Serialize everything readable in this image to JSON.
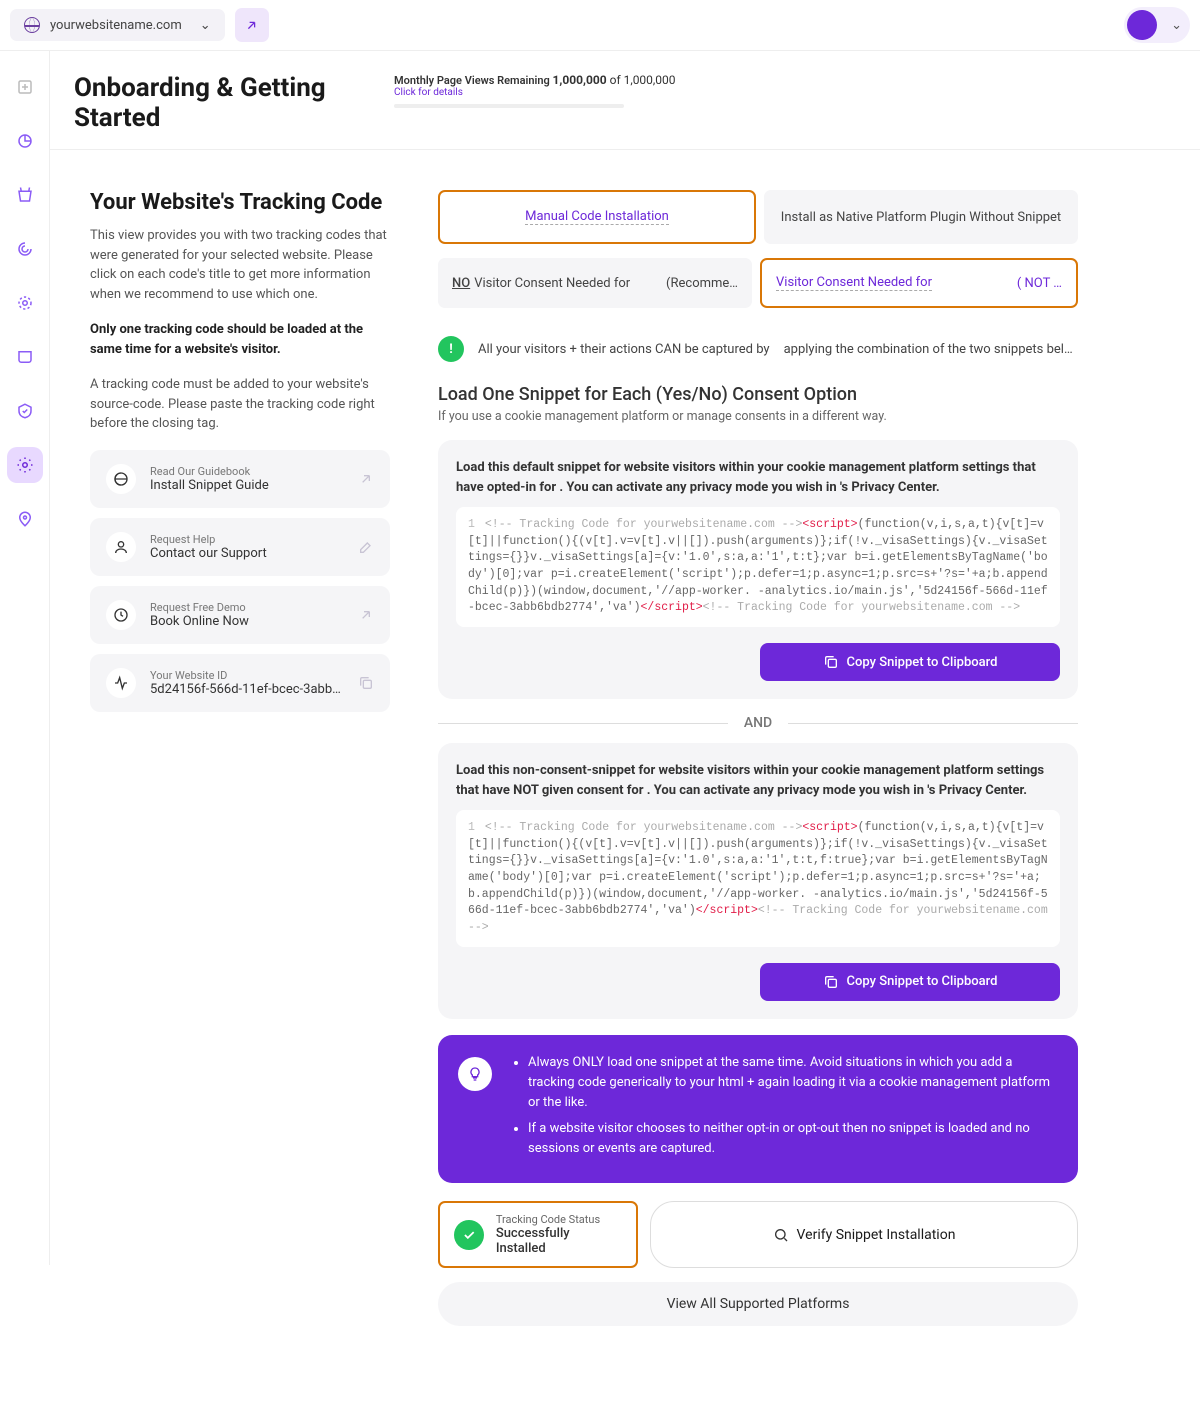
{
  "topbar": {
    "site": "yourwebsitename.com"
  },
  "header": {
    "title": "Onboarding & Getting Started",
    "statsLabel": "Monthly Page Views Remaining",
    "statsClick": "Click for details",
    "statsValue": "1,000,000",
    "statsOf": "of 1,000,000"
  },
  "left": {
    "sectionTitle": "Your Website's Tracking Code",
    "p1": "This view provides you with two tracking codes that were generated for your selected website. Please click on each code's title to get more information when we recommend to use which one.",
    "p2": "Only one tracking code should be loaded at the same time for a website's visitor.",
    "p3": "A tracking code must be added to your website's source-code. Please paste the tracking code right before the closing tag.",
    "cards": [
      {
        "sub": "Read Our Guidebook",
        "main": "Install Snippet Guide"
      },
      {
        "sub": "Request Help",
        "main": "Contact our Support"
      },
      {
        "sub": "Request Free Demo",
        "main": "Book Online Now"
      },
      {
        "sub": "Your Website ID",
        "main": "5d24156f-566d-11ef-bcec-3abb…"
      }
    ]
  },
  "tabs": {
    "t1": "Manual Code Installation",
    "t2": "Install as Native Platform Plugin Without Snippet"
  },
  "consent": {
    "leftNo": "NO",
    "leftText": "Visitor Consent Needed for",
    "leftTrail": "(Recomme…",
    "rightText": "Visitor Consent Needed for",
    "rightTrail": "(          NOT …"
  },
  "info": {
    "a": "All your visitors + their actions CAN be captured by",
    "b": "applying the combination of the two snippets bel…"
  },
  "section": {
    "heading": "Load One Snippet for Each (Yes/No) Consent Option",
    "desc": "If you use a cookie management platform or manage consents in a different way."
  },
  "snippet1": {
    "title": "Load this default snippet for website visitors within your cookie management platform settings that have opted-in for            . You can activate any privacy mode you wish in            's Privacy Center.",
    "pre": "<!--          Tracking Code for yourwebsitename.com -->",
    "tag1": "<script>",
    "body": "(function(v,i,s,a,t){v[t]=v[t]||function(){(v[t].v=v[t].v||[]).push(arguments)};if(!v._visaSettings){v._visaSettings={}}v._visaSettings[a]={v:'1.0',s:a,a:'1',t:t};var b=i.getElementsByTagName('body')[0];var p=i.createElement('script');p.defer=1;p.async=1;p.src=s+'?s='+a;b.appendChild(p)})(window,document,'//app-worker.        -analytics.io/main.js','5d24156f-566d-11ef-bcec-3abb6bdb2774','va')",
    "tag2": "</script>",
    "post": "<!--          Tracking Code for yourwebsitename.com -->"
  },
  "snippet2": {
    "title": "Load this non-consent-snippet for website visitors within your cookie management platform settings that have NOT given consent for            . You can activate any privacy mode you wish in            's Privacy Center.",
    "pre": "<!--          Tracking Code for yourwebsitename.com -->",
    "tag1": "<script>",
    "body": "(function(v,i,s,a,t){v[t]=v[t]||function(){(v[t].v=v[t].v||[]).push(arguments)};if(!v._visaSettings){v._visaSettings={}}v._visaSettings[a]={v:'1.0',s:a,a:'1',t:t,f:true};var b=i.getElementsByTagName('body')[0];var p=i.createElement('script');p.defer=1;p.async=1;p.src=s+'?s='+a;b.appendChild(p)})(window,document,'//app-worker.        -analytics.io/main.js','5d24156f-566d-11ef-bcec-3abb6bdb2774','va')",
    "tag2": "</script>",
    "post": "<!--          Tracking Code for yourwebsitename.com -->"
  },
  "copyBtn": "Copy Snippet to Clipboard",
  "and": "AND",
  "tips": {
    "a": "Always ONLY load one snippet at the same time. Avoid situations in which you add a tracking code generically to your html + again loading it via a cookie management platform or the like.",
    "b": "If a website visitor chooses to neither opt-in or opt-out then no snippet is loaded and no sessions or events are captured."
  },
  "status": {
    "sub": "Tracking Code Status",
    "main": "Successfully Installed",
    "verify": "Verify Snippet Installation"
  },
  "viewAll": "View All Supported Platforms"
}
